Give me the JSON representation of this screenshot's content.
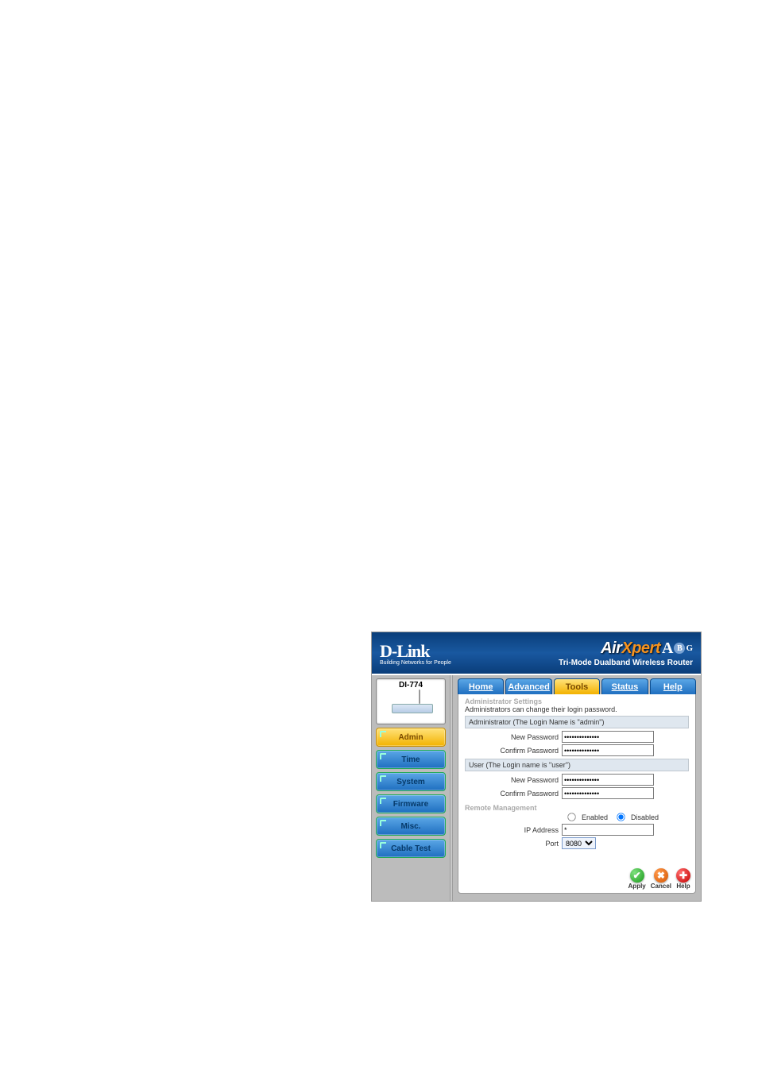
{
  "logo": {
    "brand": "D-Link",
    "tagline": "Building Networks for People"
  },
  "product": {
    "air": "Air",
    "xpert": "Xpert",
    "abg": "ABG",
    "subtitle": "Tri-Mode Dualband Wireless Router",
    "model": "DI-774"
  },
  "sidenav": {
    "items": [
      {
        "label": "Admin",
        "active": true
      },
      {
        "label": "Time"
      },
      {
        "label": "System"
      },
      {
        "label": "Firmware"
      },
      {
        "label": "Misc."
      },
      {
        "label": "Cable Test"
      }
    ]
  },
  "tabs": [
    {
      "label": "Home"
    },
    {
      "label": "Advanced"
    },
    {
      "label": "Tools",
      "active": true
    },
    {
      "label": "Status"
    },
    {
      "label": "Help"
    }
  ],
  "admin": {
    "title": "Administrator Settings",
    "subtitle": "Administrators can change their login password.",
    "admin_bar": "Administrator (The Login Name is \"admin\")",
    "user_bar": "User (The Login name is \"user\")",
    "new_pw_label": "New Password",
    "confirm_pw_label": "Confirm Password",
    "admin_pw": "●●●●●●●●●●●●●●",
    "admin_pw2": "●●●●●●●●●●●●●●",
    "user_pw": "●●●●●●●●●●●●●●",
    "user_pw2": "●●●●●●●●●●●●●●"
  },
  "remote": {
    "title": "Remote Management",
    "enabled_label": "Enabled",
    "disabled_label": "Disabled",
    "ip_label": "IP Address",
    "ip_value": "*",
    "port_label": "Port",
    "port_value": "8080"
  },
  "actions": {
    "apply": "Apply",
    "cancel": "Cancel",
    "help": "Help"
  }
}
